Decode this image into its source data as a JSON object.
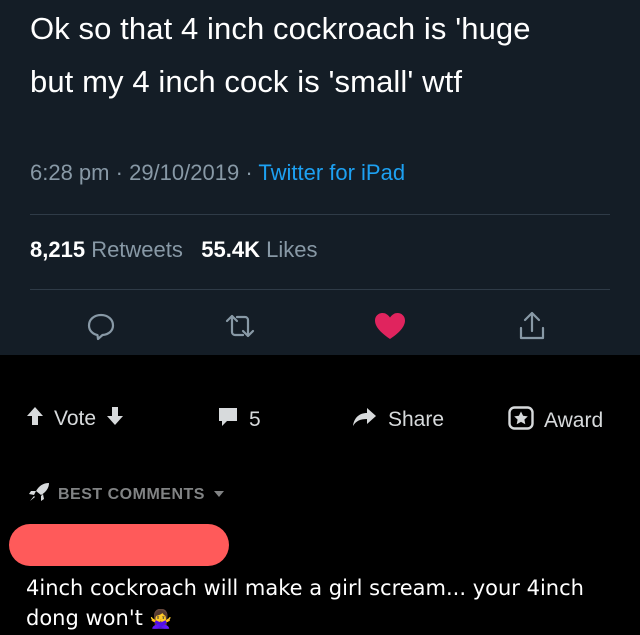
{
  "tweet": {
    "text_line1": "Ok so that 4 inch cockroach is 'huge",
    "text_line2": "but my 4 inch cock is 'small' wtf",
    "time": "6:28 pm",
    "date": "29/10/2019",
    "source": "Twitter for iPad",
    "retweets_count": "8,215",
    "retweets_label": "Retweets",
    "likes_count": "55.4K",
    "likes_label": "Likes",
    "colors": {
      "background": "#141d26",
      "meta": "#8899a6",
      "link": "#1da1f2",
      "like": "#e0245e"
    },
    "action_icons": [
      "reply-icon",
      "retweet-icon",
      "like-heart-icon",
      "share-icon"
    ]
  },
  "post_bar": {
    "vote_label": "Vote",
    "comments_count": "5",
    "share_label": "Share",
    "award_label": "Award"
  },
  "comments": {
    "sort_label": "BEST COMMENTS",
    "redaction_color": "#ff5a5a",
    "top_comment_line1": "4inch cockroach will make a girl scream... your 4inch",
    "top_comment_line2": "dong won't",
    "top_comment_emoji": "🙅‍♀️"
  }
}
